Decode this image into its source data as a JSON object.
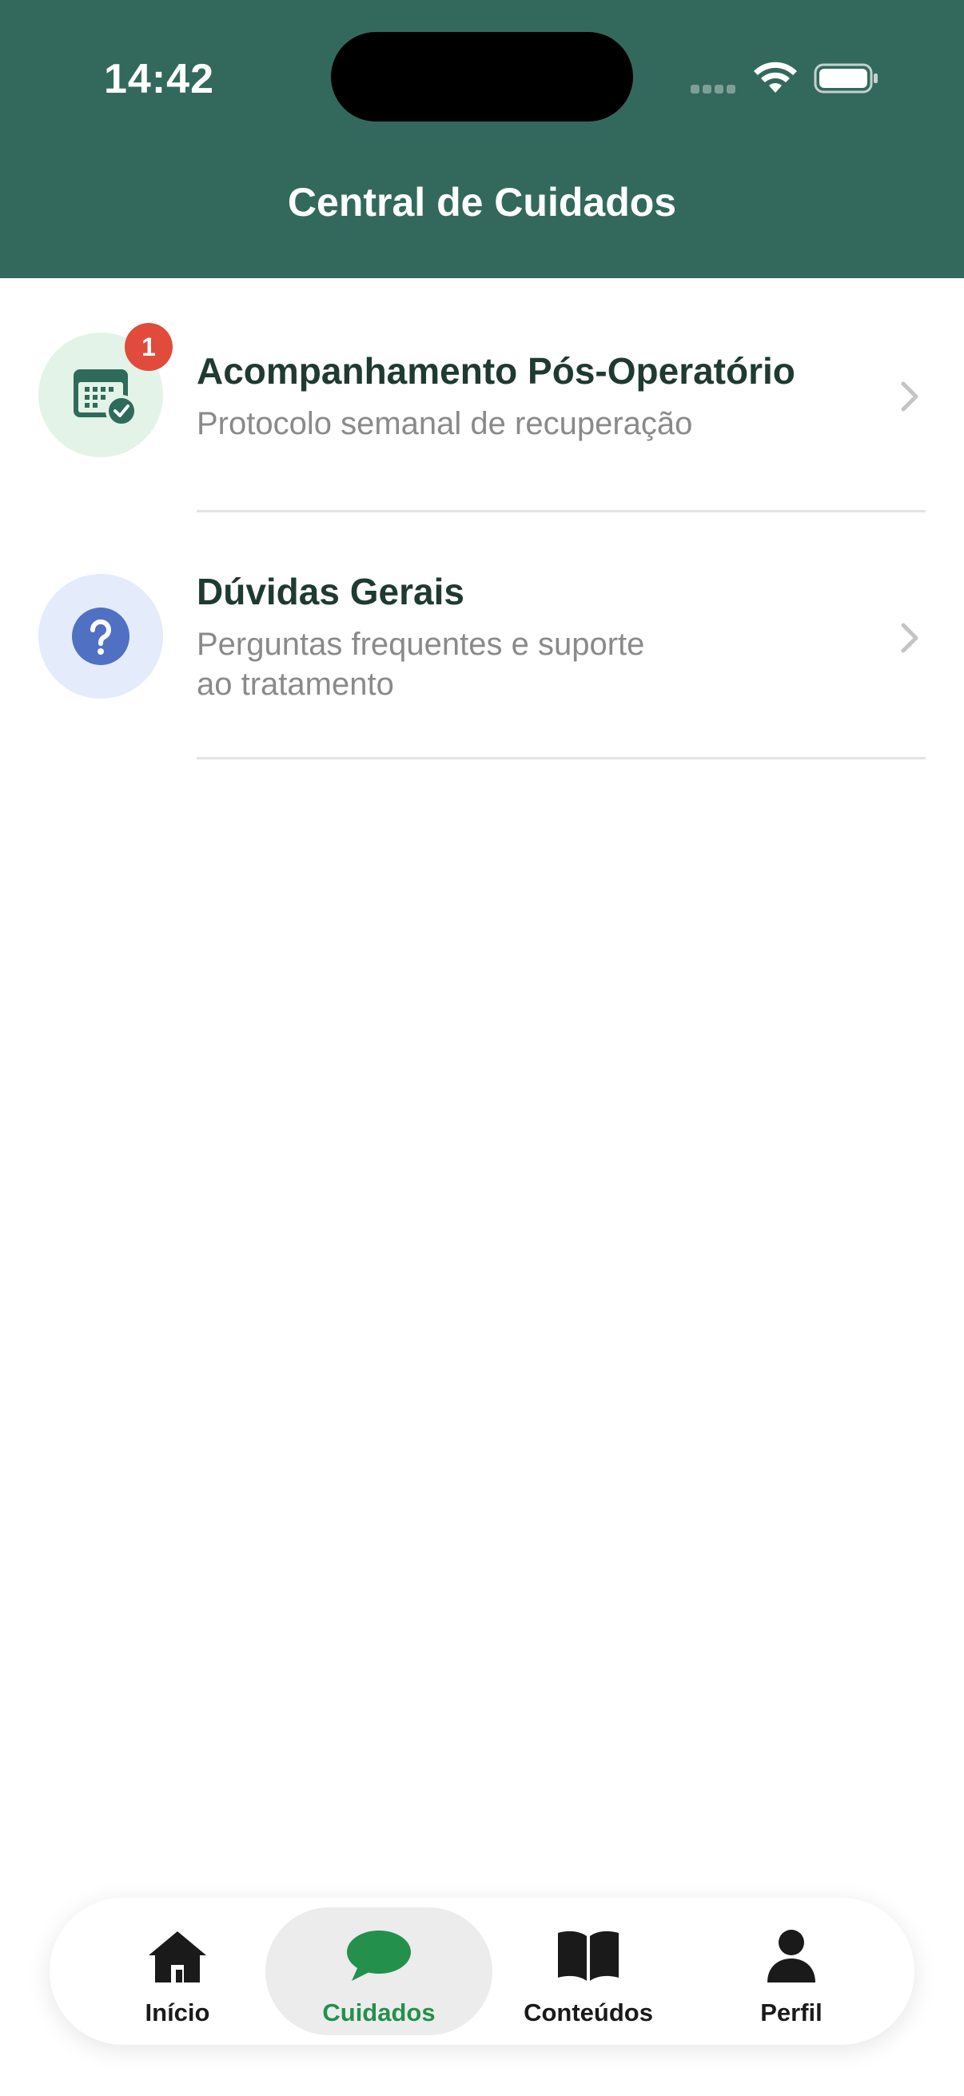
{
  "status_bar": {
    "time": "14:42"
  },
  "header": {
    "title": "Central de Cuidados"
  },
  "list": {
    "items": [
      {
        "title": "Acompanhamento Pós-Operatório",
        "subtitle": "Protocolo semanal de recuperação",
        "icon": "calendar-check-icon",
        "badge": "1",
        "icon_bg": "#e3f3e7",
        "icon_color": "#2f6b5a"
      },
      {
        "title": "Dúvidas Gerais",
        "subtitle_line1": "Perguntas frequentes e suporte",
        "subtitle_line2": "ao tratamento",
        "icon": "question-circle-icon",
        "icon_bg": "#e4ebfb",
        "icon_color": "#4f70c3"
      }
    ]
  },
  "tab_bar": {
    "tabs": [
      {
        "label": "Início",
        "icon": "home-icon",
        "active": false
      },
      {
        "label": "Cuidados",
        "icon": "chat-bubble-icon",
        "active": true
      },
      {
        "label": "Conteúdos",
        "icon": "book-icon",
        "active": false
      },
      {
        "label": "Perfil",
        "icon": "person-icon",
        "active": false
      }
    ]
  },
  "colors": {
    "header_bg": "#33695c",
    "accent_green": "#23904c",
    "badge_red": "#e04b3c",
    "title_text": "#1f3a31",
    "subtitle_text": "#8a8a8a"
  }
}
